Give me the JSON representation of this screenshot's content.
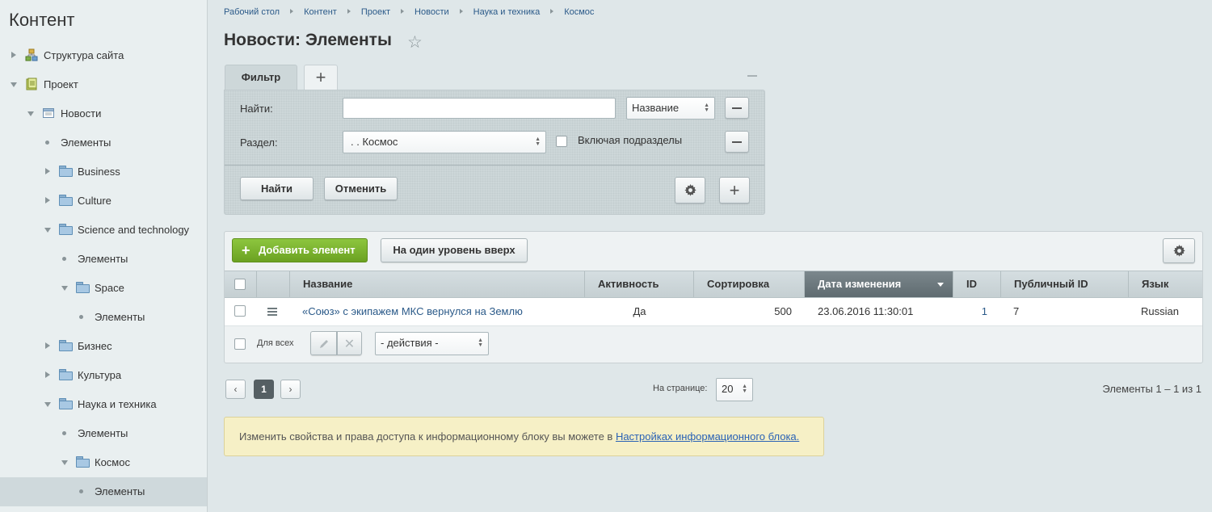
{
  "sidebar": {
    "title": "Контент",
    "items": [
      {
        "label": "Структура сайта",
        "state": "collapsed",
        "icon": "site-structure-icon"
      },
      {
        "label": "Проект",
        "state": "expanded",
        "icon": "iblock-type-icon"
      },
      {
        "label": "Новости",
        "state": "expanded",
        "icon": "iblock-icon"
      },
      {
        "label": "Элементы",
        "state": "leaf"
      },
      {
        "label": "Business",
        "state": "collapsed",
        "icon": "folder-icon"
      },
      {
        "label": "Culture",
        "state": "collapsed",
        "icon": "folder-icon"
      },
      {
        "label": "Science and technology",
        "state": "expanded",
        "icon": "folder-icon"
      },
      {
        "label": "Элементы",
        "state": "leaf"
      },
      {
        "label": "Space",
        "state": "expanded",
        "icon": "folder-icon"
      },
      {
        "label": "Элементы",
        "state": "leaf"
      },
      {
        "label": "Бизнес",
        "state": "collapsed",
        "icon": "folder-icon"
      },
      {
        "label": "Культура",
        "state": "collapsed",
        "icon": "folder-icon"
      },
      {
        "label": "Наука и техника",
        "state": "expanded",
        "icon": "folder-icon"
      },
      {
        "label": "Элементы",
        "state": "leaf"
      },
      {
        "label": "Космос",
        "state": "expanded",
        "icon": "folder-icon"
      },
      {
        "label": "Элементы",
        "state": "leaf",
        "selected": true
      }
    ]
  },
  "breadcrumb": [
    "Рабочий стол",
    "Контент",
    "Проект",
    "Новости",
    "Наука и техника",
    "Космос"
  ],
  "page": {
    "title": "Новости: Элементы"
  },
  "filter": {
    "tab_label": "Фильтр",
    "find_label": "Найти:",
    "find_value": "",
    "find_field_select": "Название",
    "section_label": "Раздел:",
    "section_value": ". . Космос",
    "include_subsections_label": "Включая подразделы",
    "find_button": "Найти",
    "cancel_button": "Отменить"
  },
  "toolbar": {
    "add_button": "Добавить элемент",
    "up_button": "На один уровень вверх"
  },
  "table": {
    "columns": [
      "Название",
      "Активность",
      "Сортировка",
      "Дата изменения",
      "ID",
      "Публичный ID",
      "Язык"
    ],
    "sorted_column": "Дата изменения",
    "rows": [
      {
        "name": "«Союз» с экипажем МКС вернулся на Землю",
        "active": "Да",
        "sort": "500",
        "date": "23.06.2016 11:30:01",
        "id": "1",
        "public_id": "7",
        "lang": "Russian"
      }
    ],
    "for_all_label": "Для всех",
    "actions_select": "- действия -"
  },
  "pager": {
    "prev": "‹",
    "current": "1",
    "next": "›",
    "per_page_label": "На странице:",
    "per_page_value": "20",
    "summary": "Элементы 1 – 1 из 1"
  },
  "info": {
    "text": "Изменить свойства и права доступа к информационному блоку вы можете в ",
    "link": "Настройках информационного блока."
  }
}
